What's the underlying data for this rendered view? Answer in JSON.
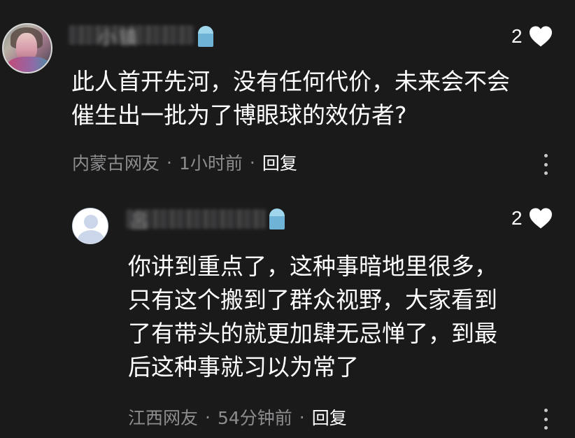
{
  "comment": {
    "author": "小镇",
    "likes": "2",
    "text": "此人首开先河，没有任何代价，未来会不会\n催生出一批为了博眼球的效仿者?",
    "location": "内蒙古网友",
    "time": "1小时前",
    "reply_label": "回复"
  },
  "reply": {
    "author": "吕",
    "likes": "2",
    "text": "你讲到重点了，这种事暗地里很多，\n只有这个搬到了群众视野，大家看到\n了有带头的就更加肆无忌惮了，到最\n后这种事就习以为常了",
    "location": "江西网友",
    "time": "54分钟前",
    "reply_label": "回复"
  },
  "separator": "·",
  "icons": {
    "like": "heart-icon",
    "more": "more-vertical-icon",
    "badge": "level-badge-icon"
  },
  "colors": {
    "background": "#1a1a1b",
    "text": "#ffffff",
    "muted": "#8d8d8f",
    "badge": "#6fb3d6"
  }
}
